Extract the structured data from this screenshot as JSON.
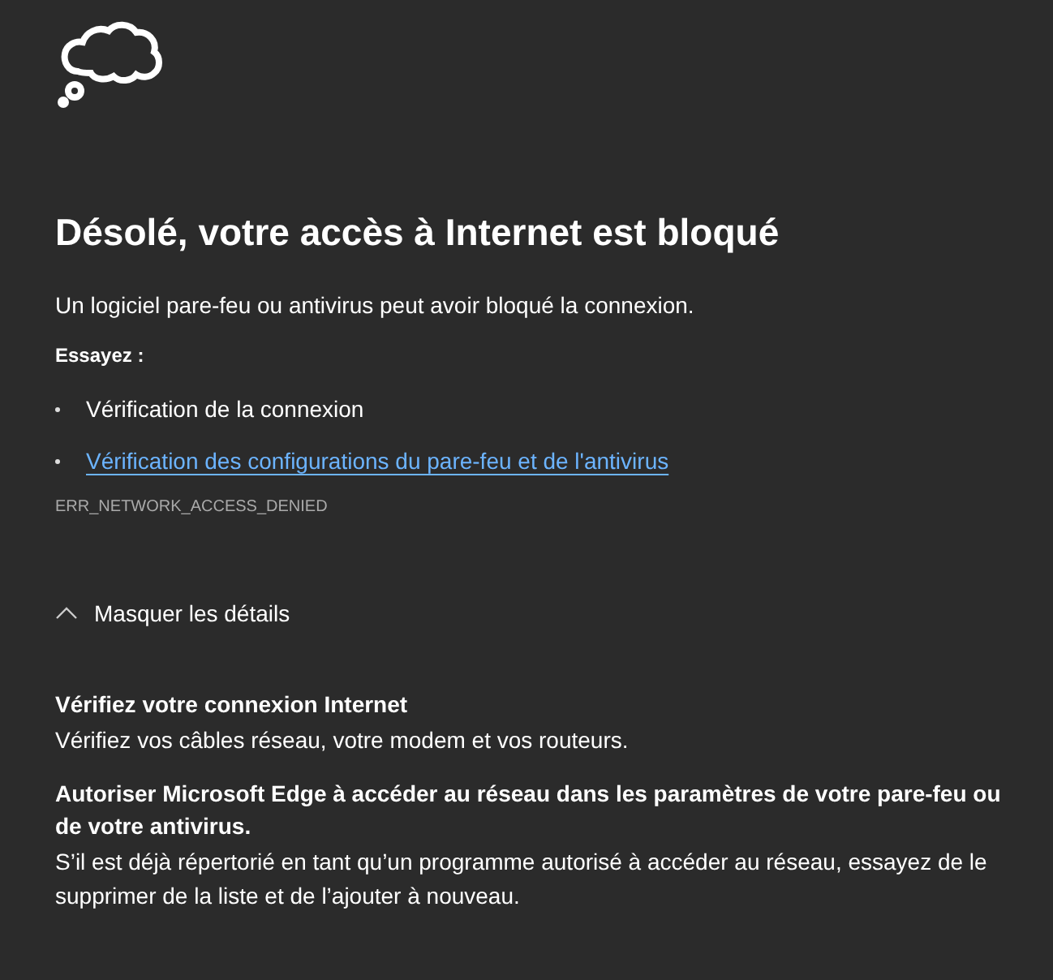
{
  "title": "Désolé, votre accès à Internet est bloqué",
  "message": "Un logiciel pare-feu ou antivirus peut avoir bloqué la connexion.",
  "try_label": "Essayez :",
  "suggestions": [
    {
      "kind": "text",
      "text": "Vérification de la connexion"
    },
    {
      "kind": "link",
      "text": "Vérification des configurations du pare-feu et de l'antivirus"
    }
  ],
  "error_code": "ERR_NETWORK_ACCESS_DENIED",
  "details_toggle": {
    "label": "Masquer les détails",
    "expanded": true
  },
  "details": [
    {
      "heading": "Vérifiez votre connexion Internet",
      "text": "Vérifiez vos câbles réseau, votre modem et vos routeurs."
    },
    {
      "heading": "Autoriser Microsoft Edge à accéder au réseau dans les paramètres de votre pare-feu ou de votre antivirus.",
      "text": "S’il est déjà répertorié en tant qu’un programme autorisé à accéder au réseau, essayez de le supprimer de la liste et de l’ajouter à nouveau."
    }
  ]
}
